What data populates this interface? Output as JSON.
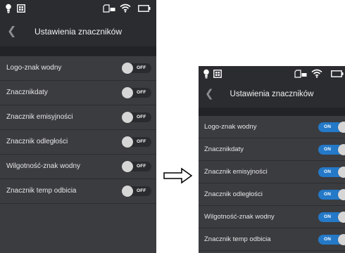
{
  "left_screen": {
    "title": "Ustawienia znaczników",
    "rows": [
      {
        "label": "Logo-znak wodny",
        "toggle": "OFF"
      },
      {
        "label": "Znacznikdaty",
        "toggle": "OFF"
      },
      {
        "label": "Znacznik emisyjności",
        "toggle": "OFF"
      },
      {
        "label": "Znacznik odległości",
        "toggle": "OFF"
      },
      {
        "label": "Wilgotność-znak wodny",
        "toggle": "OFF"
      },
      {
        "label": "Znacznik temp odbicia",
        "toggle": "OFF"
      }
    ]
  },
  "right_screen": {
    "title": "Ustawienia znaczników",
    "rows": [
      {
        "label": "Logo-znak wodny",
        "toggle": "ON"
      },
      {
        "label": "Znacznikdaty",
        "toggle": "ON"
      },
      {
        "label": "Znacznik emisyjności",
        "toggle": "ON"
      },
      {
        "label": "Znacznik odległości",
        "toggle": "ON"
      },
      {
        "label": "Wilgotność-znak wodny",
        "toggle": "ON"
      },
      {
        "label": "Znacznik temp odbicia",
        "toggle": "ON"
      }
    ]
  },
  "icons": {
    "status_bar": [
      "bulb-icon",
      "sim-icon",
      "sd-card-icon",
      "wifi-icon",
      "battery-icon"
    ],
    "back": "chevron-left-icon",
    "transition": "arrow-right-icon"
  },
  "colors": {
    "screen_bg": "#3b3c40",
    "header_bg": "#2b2c30",
    "toggle_on": "#2479c8",
    "toggle_off": "#2a2b2e",
    "knob": "#d6d6d6"
  }
}
